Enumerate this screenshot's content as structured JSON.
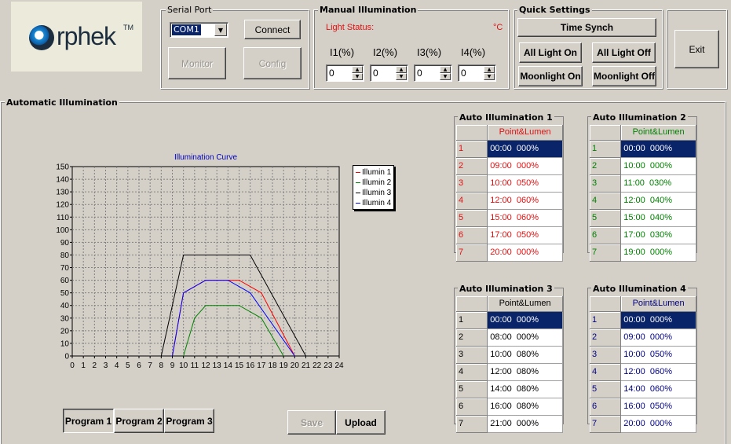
{
  "logo": {
    "text": "rphek",
    "tm": "TM"
  },
  "serial_port": {
    "title": "Serial Port",
    "com_value": "COM1",
    "connect": "Connect",
    "monitor": "Monitor",
    "config": "Config"
  },
  "manual": {
    "title": "Manual Illumination",
    "light_status": "Light Status:",
    "unit": "°C",
    "labels": [
      "I1(%)",
      "I2(%)",
      "I3(%)",
      "I4(%)"
    ],
    "values": [
      "0",
      "0",
      "0",
      "0"
    ]
  },
  "quick": {
    "title": "Quick Settings",
    "time_synch": "Time Synch",
    "all_on": "All Light On",
    "all_off": "All Light Off",
    "moon_on": "Moonlight On",
    "moon_off": "Moonlight Off"
  },
  "exit": "Exit",
  "auto": {
    "title": "Automatic Illumination",
    "save": "Save",
    "upload": "Upload",
    "programs": [
      "Program 1",
      "Program 2",
      "Program 3"
    ]
  },
  "chart_data": {
    "type": "line",
    "title": "Illumination Curve",
    "xlabel": "",
    "ylabel": "",
    "xlim": [
      0,
      24
    ],
    "ylim": [
      0,
      150
    ],
    "x_ticks": [
      "0",
      "1",
      "2",
      "3",
      "4",
      "5",
      "6",
      "7",
      "8",
      "9",
      "10",
      "11",
      "12",
      "13",
      "14",
      "15",
      "16",
      "17",
      "18",
      "19",
      "20",
      "21",
      "22",
      "23",
      "24"
    ],
    "y_ticks": [
      "0",
      "10",
      "20",
      "30",
      "40",
      "50",
      "60",
      "70",
      "80",
      "90",
      "100",
      "110",
      "120",
      "130",
      "140",
      "150"
    ],
    "grid": true,
    "legend": "top-right",
    "series": [
      {
        "name": "Illumin 1",
        "color": "#ff0000",
        "points": [
          [
            9,
            0
          ],
          [
            10,
            50
          ],
          [
            12,
            60
          ],
          [
            15,
            60
          ],
          [
            17,
            50
          ],
          [
            20,
            0
          ]
        ]
      },
      {
        "name": "Illumin 2",
        "color": "#008000",
        "points": [
          [
            10,
            0
          ],
          [
            11,
            30
          ],
          [
            12,
            40
          ],
          [
            15,
            40
          ],
          [
            17,
            30
          ],
          [
            19,
            0
          ]
        ]
      },
      {
        "name": "Illumin 3",
        "color": "#000000",
        "points": [
          [
            8,
            0
          ],
          [
            10,
            80
          ],
          [
            12,
            80
          ],
          [
            14,
            80
          ],
          [
            16,
            80
          ],
          [
            21,
            0
          ]
        ]
      },
      {
        "name": "Illumin 4",
        "color": "#0000ff",
        "points": [
          [
            9,
            0
          ],
          [
            10,
            50
          ],
          [
            12,
            60
          ],
          [
            14,
            60
          ],
          [
            16,
            50
          ],
          [
            20,
            0
          ]
        ]
      }
    ]
  },
  "tables": [
    {
      "title": "Auto Illumination 1",
      "header": "Point&Lumen",
      "color": "#e01010",
      "rows": [
        [
          "1",
          "00:00  000%"
        ],
        [
          "2",
          "09:00  000%"
        ],
        [
          "3",
          "10:00  050%"
        ],
        [
          "4",
          "12:00  060%"
        ],
        [
          "5",
          "15:00  060%"
        ],
        [
          "6",
          "17:00  050%"
        ],
        [
          "7",
          "20:00  000%"
        ]
      ]
    },
    {
      "title": "Auto Illumination 2",
      "header": "Point&Lumen",
      "color": "#008000",
      "rows": [
        [
          "1",
          "00:00  000%"
        ],
        [
          "2",
          "10:00  000%"
        ],
        [
          "3",
          "11:00  030%"
        ],
        [
          "4",
          "12:00  040%"
        ],
        [
          "5",
          "15:00  040%"
        ],
        [
          "6",
          "17:00  030%"
        ],
        [
          "7",
          "19:00  000%"
        ]
      ]
    },
    {
      "title": "Auto Illumination 3",
      "header": "Point&Lumen",
      "color": "#000000",
      "rows": [
        [
          "1",
          "00:00  000%"
        ],
        [
          "2",
          "08:00  000%"
        ],
        [
          "3",
          "10:00  080%"
        ],
        [
          "4",
          "12:00  080%"
        ],
        [
          "5",
          "14:00  080%"
        ],
        [
          "6",
          "16:00  080%"
        ],
        [
          "7",
          "21:00  000%"
        ]
      ]
    },
    {
      "title": "Auto Illumination 4",
      "header": "Point&Lumen",
      "color": "#000080",
      "rows": [
        [
          "1",
          "00:00  000%"
        ],
        [
          "2",
          "09:00  000%"
        ],
        [
          "3",
          "10:00  050%"
        ],
        [
          "4",
          "12:00  060%"
        ],
        [
          "5",
          "14:00  060%"
        ],
        [
          "6",
          "16:00  050%"
        ],
        [
          "7",
          "20:00  000%"
        ]
      ]
    }
  ]
}
